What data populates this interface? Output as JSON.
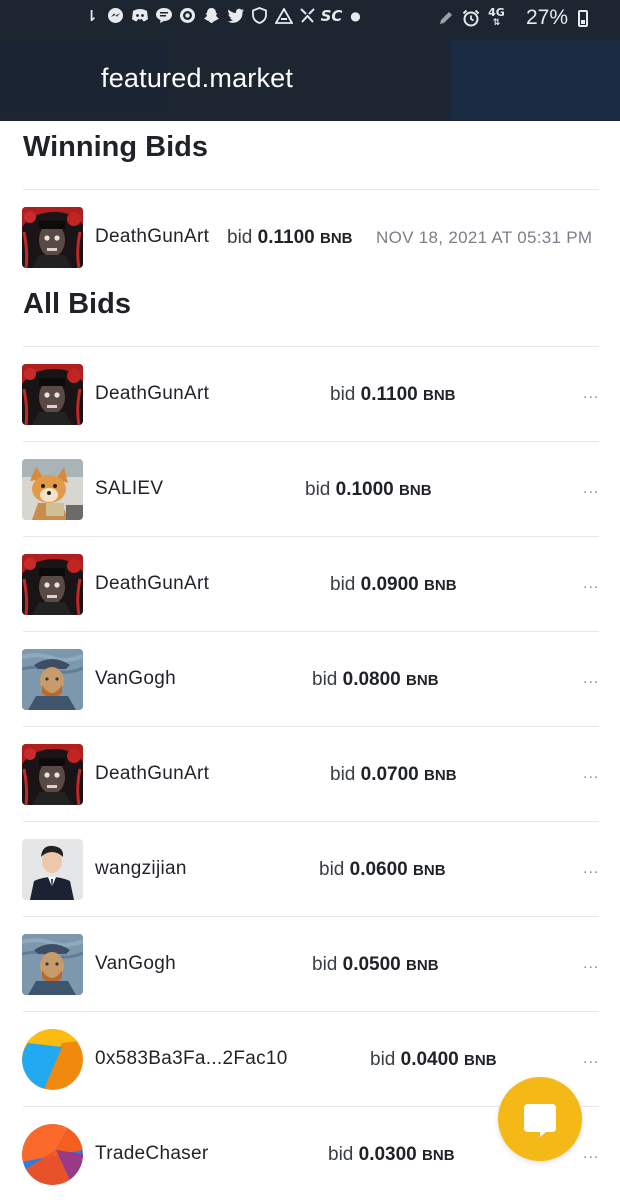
{
  "status_bar": {
    "battery": "27%",
    "network": "4G",
    "left_icons": [
      "download-icon",
      "messenger-icon",
      "discord-icon",
      "chat-icon",
      "target-icon",
      "snapchat-icon",
      "twitter-icon",
      "shield-icon",
      "warning-icon",
      "notification-icon",
      "soundcloud-icon",
      "dot-icon"
    ],
    "right_icons": [
      "pen-icon",
      "alarm-icon",
      "signal-icon"
    ]
  },
  "browser": {
    "url": "featured.market"
  },
  "winning_bids": {
    "title": "Winning Bids",
    "items": [
      {
        "user": "DeathGunArt",
        "bid_prefix": "bid",
        "amount": "0.1100",
        "currency": "BNB",
        "date": "NOV 18, 2021 AT 05:31 PM",
        "avatar": "deathgunart-avatar"
      }
    ]
  },
  "all_bids": {
    "title": "All Bids",
    "more_label": "...",
    "items": [
      {
        "user": "DeathGunArt",
        "bid_prefix": "bid",
        "amount": "0.1100",
        "currency": "BNB",
        "avatar": "deathgunart-avatar"
      },
      {
        "user": "SALIEV",
        "bid_prefix": "bid",
        "amount": "0.1000",
        "currency": "BNB",
        "avatar": "dog-avatar"
      },
      {
        "user": "DeathGunArt",
        "bid_prefix": "bid",
        "amount": "0.0900",
        "currency": "BNB",
        "avatar": "deathgunart-avatar"
      },
      {
        "user": "VanGogh",
        "bid_prefix": "bid",
        "amount": "0.0800",
        "currency": "BNB",
        "avatar": "vangogh-avatar"
      },
      {
        "user": "DeathGunArt",
        "bid_prefix": "bid",
        "amount": "0.0700",
        "currency": "BNB",
        "avatar": "deathgunart-avatar"
      },
      {
        "user": "wangzijian",
        "bid_prefix": "bid",
        "amount": "0.0600",
        "currency": "BNB",
        "avatar": "person-avatar"
      },
      {
        "user": "VanGogh",
        "bid_prefix": "bid",
        "amount": "0.0500",
        "currency": "BNB",
        "avatar": "vangogh-avatar"
      },
      {
        "user": "0x583Ba3Fa...2Fac10",
        "bid_prefix": "bid",
        "amount": "0.0400",
        "currency": "BNB",
        "avatar": "blue-orange-avatar"
      },
      {
        "user": "TradeChaser",
        "bid_prefix": "bid",
        "amount": "0.0300",
        "currency": "BNB",
        "avatar": "red-blue-avatar"
      }
    ]
  },
  "colors": {
    "header_bg": "#1c2530",
    "chat_fab": "#f4b817",
    "divider": "#e6e8eb",
    "date_text": "#7a8089"
  },
  "chat_button": {
    "icon": "chat-bubble-icon"
  }
}
